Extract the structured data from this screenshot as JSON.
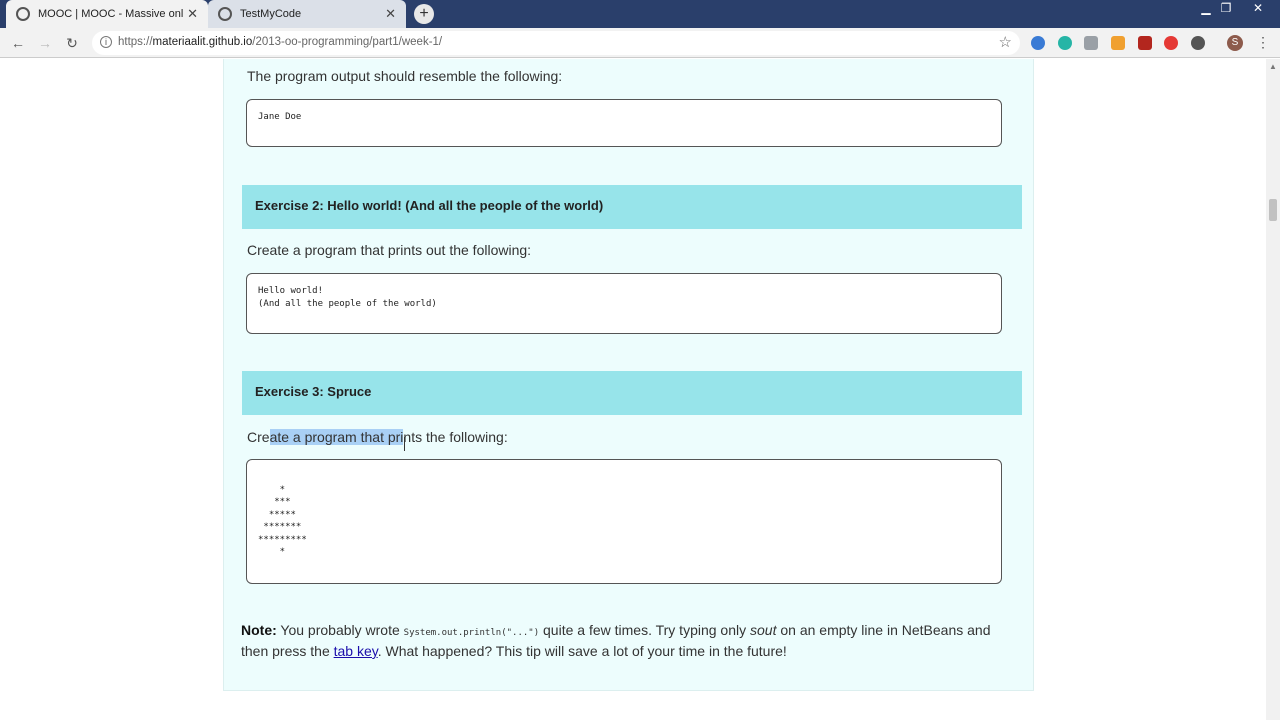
{
  "browser": {
    "tabs": [
      {
        "title": "MOOC | MOOC - Massive online",
        "active": true
      },
      {
        "title": "TestMyCode",
        "active": false
      }
    ],
    "new_tab_label": "+",
    "url_prefix": "https://",
    "url_host": "materiaalit.github.io",
    "url_path": "/2013-oo-programming/part1/week-1/"
  },
  "page": {
    "output_intro": "The program output should resemble the following:",
    "output_code": "Jane Doe",
    "exercise2": {
      "title": "Exercise 2: Hello world! (And all the people of the world)",
      "intro": "Create a program that prints out the following:",
      "code": "Hello world!\n(And all the people of the world)"
    },
    "exercise3": {
      "title": "Exercise 3: Spruce",
      "intro_start": "Cre",
      "intro_highlight": "ate a program that pri",
      "intro_end": "nts the following:",
      "code": "\n    *\n   ***\n  *****\n *******\n*********\n    *"
    },
    "note": {
      "label": "Note:",
      "text1": " You probably wrote ",
      "code": "System.out.println(\"...\")",
      "text2": " quite a few times. Try typing only ",
      "emphasis": "sout",
      "text3": " on an empty line in NetBeans and then press the ",
      "link": "tab key",
      "text4": ". What happened? This tip will save a lot of your time in the future!"
    }
  },
  "colors": {
    "exercise_header": "#97e4ea",
    "content_bg": "#edfdfd",
    "selection": "#a9d0f5"
  }
}
